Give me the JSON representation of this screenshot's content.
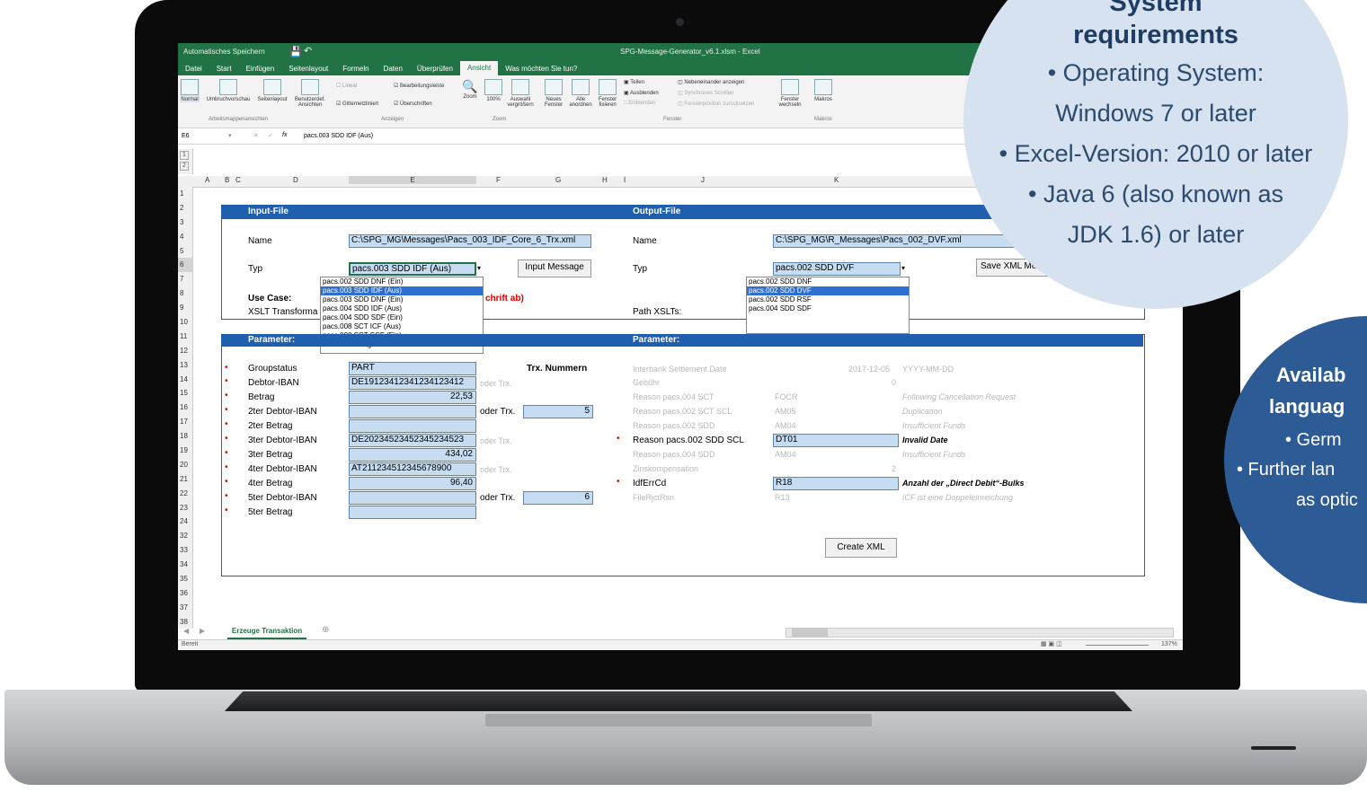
{
  "excel": {
    "title_left": "Automatisches Speichern",
    "window_title": "SPG-Message-Generator_v6.1.xlsm - Excel",
    "tabs": [
      "Datei",
      "Start",
      "Einfügen",
      "Seitenlayout",
      "Formeln",
      "Daten",
      "Überprüfen",
      "Ansicht",
      "Was möchten Sie tun?"
    ],
    "ribbon": {
      "normal": "Normal",
      "umbruch": "Umbruchvorschau",
      "seitenlayout": "Seitenlayout",
      "benutzer": "Benutzerdef. Ansichten",
      "group1": "Arbeitsmappenansichten",
      "lineal": "Lineal",
      "gitter": "Gitternetzlinien",
      "bearb": "Bearbeitungsleiste",
      "ueber": "Überschriften",
      "group2": "Anzeigen",
      "zoom": "Zoom",
      "zoom100": "100%",
      "auswahl": "Auswahl vergrößern",
      "group3": "Zoom",
      "neues": "Neues Fenster",
      "alle": "Alle anordnen",
      "fixieren": "Fenster fixieren",
      "teilen": "Teilen",
      "ausblenden": "Ausblenden",
      "einblenden": "Einblenden",
      "neben": "Nebeneinander anzeigen",
      "synchron": "Synchrones Scrollen",
      "fensterpos": "Fensterposition zurücksetzen",
      "wechseln": "Fenster wechseln",
      "group4": "Fenster",
      "makros": "Makros",
      "group5": "Makros"
    },
    "name_box": "E6",
    "formula": "pacs.003 SDD IDF (Aus)",
    "columns": [
      "A",
      "B",
      "C",
      "D",
      "E",
      "F",
      "G",
      "H",
      "I",
      "J",
      "K"
    ],
    "rows": [
      "1",
      "2",
      "3",
      "4",
      "5",
      "6",
      "7",
      "8",
      "9",
      "10",
      "11",
      "12",
      "13",
      "14",
      "15",
      "16",
      "17",
      "18",
      "19",
      "20",
      "21",
      "22",
      "23",
      "24",
      "32",
      "33",
      "34",
      "35",
      "36",
      "37",
      "38"
    ],
    "input": {
      "header": "Input-File",
      "name_label": "Name",
      "name_value": "C:\\SPG_MG\\Messages\\Pacs_003_IDF_Core_6_Trx.xml",
      "typ_label": "Typ",
      "typ_value": "pacs.003 SDD IDF (Aus)",
      "input_button": "Input Message",
      "usecase_label": "Use Case:",
      "xslt_label": "XSLT Transforma",
      "red_note": "chrift ab)",
      "dropdown": [
        "pacs.002 SDD DNF (Ein)",
        "pacs.003 SDD IDF (Aus)",
        "pacs.003 SDD DNF (Ein)",
        "pacs.004 SDD IDF (Aus)",
        "pacs.004 SDD SDF (Ein)",
        "pacs.008 SCT ICF (Aus)",
        "pacs.008 SCT SCF (Ein)",
        "Create Messages"
      ]
    },
    "output": {
      "header": "Output-File",
      "name_label": "Name",
      "name_value": "C:\\SPG_MG\\R_Messages\\Pacs_002_DVF.xml",
      "typ_label": "Typ",
      "typ_value": "pacs.002 SDD DVF",
      "save_button": "Save XML Me",
      "path_label": "Path XSLTs:",
      "dropdown": [
        "pacs.002 SDD DNF",
        "pacs.002 SDD DVF",
        "pacs.002 SDD RSF",
        "pacs.004 SDD SDF"
      ]
    },
    "param_left": {
      "header": "Parameter:",
      "trx_header": "Trx. Nummern",
      "oder": "oder Trx.",
      "rows": [
        {
          "label": "Groupstatus",
          "value": "PART"
        },
        {
          "label": "Debtor-IBAN",
          "value": "DE19123412341234123412"
        },
        {
          "label": "Betrag",
          "value": "22,53"
        },
        {
          "label": "2ter Debtor-IBAN",
          "value": ""
        },
        {
          "label": "2ter Betrag",
          "value": ""
        },
        {
          "label": "3ter Debtor-IBAN",
          "value": "DE20234523452345234523"
        },
        {
          "label": "3ter Betrag",
          "value": "434,02"
        },
        {
          "label": "4ter Debtor-IBAN",
          "value": "AT211234512345678900"
        },
        {
          "label": "4ter Betrag",
          "value": "96,40"
        },
        {
          "label": "5ter Debtor-IBAN",
          "value": ""
        },
        {
          "label": "5ter Betrag",
          "value": ""
        }
      ],
      "trx1": "5",
      "trx2": "6"
    },
    "param_right": {
      "header": "Parameter:",
      "rows": [
        {
          "label": "Interbank Settlement Date",
          "value": "2017-12-05",
          "note": "YYYY-MM-DD"
        },
        {
          "label": "Gebühr",
          "value": "0",
          "note": ""
        },
        {
          "label": "Reason pacs.004 SCT",
          "value": "FOCR",
          "note": "Following Cancellation Request"
        },
        {
          "label": "Reason pacs.002 SCT SCL",
          "value": "AM05",
          "note": "Duplication"
        },
        {
          "label": "Reason pacs.002 SDD",
          "value": "AM04",
          "note": "Insufficient Funds"
        },
        {
          "label": "Reason pacs.002 SDD SCL",
          "value": "DT01",
          "note": "Invalid Date"
        },
        {
          "label": "Reason pacs.004 SDD",
          "value": "AM04",
          "note": "Insufficient Funds"
        },
        {
          "label": "Zinskompensation",
          "value": "2",
          "note": ""
        },
        {
          "label": "IdfErrCd",
          "value": "R18",
          "note": "Anzahl der „Direct Debit“-Bulks"
        },
        {
          "label": "FileRjctRsn",
          "value": "R13",
          "note": "ICF ist eine Doppeleinreichung"
        }
      ]
    },
    "create_button": "Create XML",
    "sheet_tab": "Erzeuge Transaktion",
    "status": "Bereit",
    "zoom_level": "137%"
  },
  "sysreq": {
    "title_line1": "System",
    "title_line2": "requirements",
    "items": [
      "• Operating System:",
      "Windows 7 or later",
      "• Excel-Version: 2010 or later",
      "• Java 6 (also known as",
      "JDK 1.6) or later"
    ]
  },
  "lang": {
    "title_line1": "Availab",
    "title_line2": "languag",
    "items": [
      "• Germ",
      "• Further lan",
      "as optic"
    ]
  }
}
